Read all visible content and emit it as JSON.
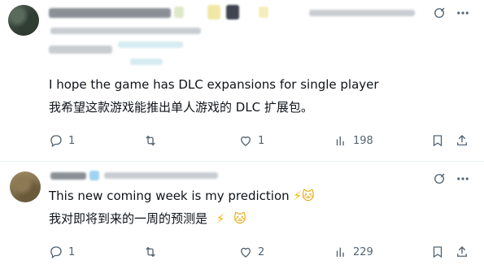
{
  "tweets": [
    {
      "text_en": "I hope the game has DLC expansions for single player",
      "text_zh": "我希望这款游戏能推出单人游戏的 DLC 扩展包。",
      "replies": "1",
      "retweets": "",
      "likes": "1",
      "views": "198"
    },
    {
      "text_en": "This new coming week is my prediction",
      "text_zh": "我对即将到来的一周的预测是",
      "replies": "1",
      "retweets": "",
      "likes": "2",
      "views": "229"
    }
  ],
  "colors": {
    "text": "#0f1419",
    "muted": "#536471",
    "grok": "#536471"
  },
  "icons": [
    "grok-icon",
    "more-icon",
    "reply-icon",
    "retweet-icon",
    "like-icon",
    "views-icon",
    "bookmark-icon",
    "share-icon",
    "lightning-emoji",
    "cat-emoji"
  ]
}
